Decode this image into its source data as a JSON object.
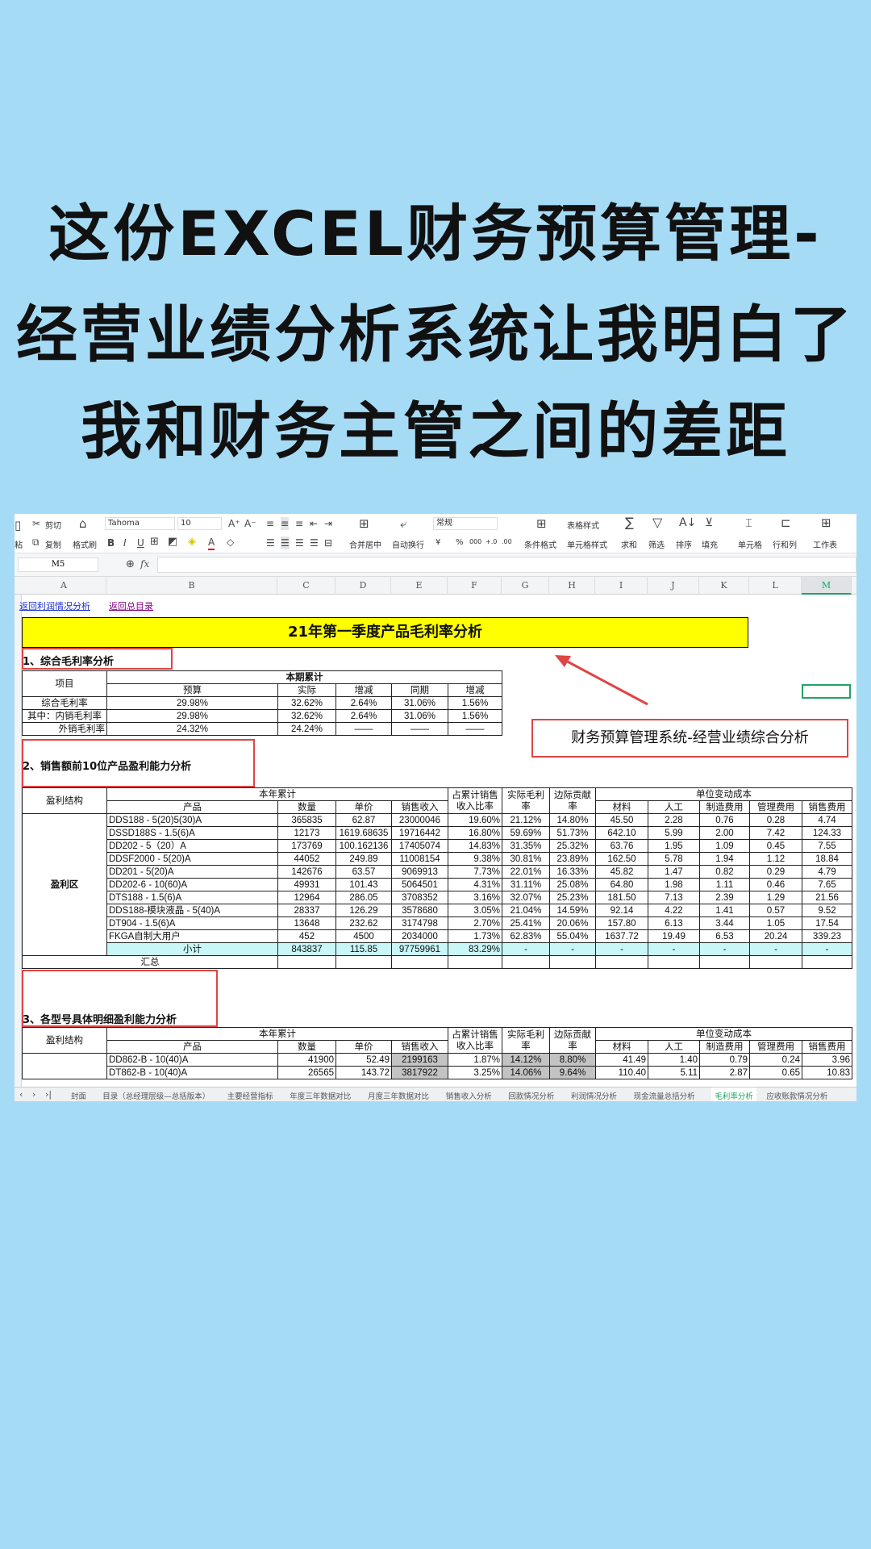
{
  "headline": {
    "lines": [
      "这份EXCEL财务预算管理-",
      "经营业绩分析系统让我明白了",
      "我和财务主管之间的差距"
    ]
  },
  "toolbar": {
    "paste": "粘",
    "cut": "剪切",
    "copy": "复制",
    "format_painter": "格式刷",
    "font": "Tahoma",
    "font_size": "10",
    "merge_center": "合并居中",
    "wrap_text": "自动换行",
    "number_format": "常规",
    "conditional_format": "条件格式",
    "table_style": "表格样式",
    "cell_style": "单元格样式",
    "sum": "求和",
    "filter": "筛选",
    "sort": "排序",
    "fill": "填充",
    "cell": "单元格",
    "row_col": "行和列",
    "worksheet": "工作表",
    "num_buttons": [
      "¥",
      "%",
      "000",
      "+.0",
      ".00"
    ]
  },
  "formula_bar": {
    "name_box": "M5",
    "fx": "fx",
    "value": ""
  },
  "columns": [
    "A",
    "B",
    "C",
    "D",
    "E",
    "F",
    "G",
    "H",
    "I",
    "J",
    "K",
    "L",
    "M"
  ],
  "selected_column": "M",
  "links": {
    "profit": "返回利润情况分析",
    "catalog": "返回总目录"
  },
  "sheet_title": "21年第一季度产品毛利率分析",
  "callout": "财务预算管理系统-经营业绩综合分析",
  "section1": {
    "heading": "1、综合毛利率分析",
    "item_header": "项目",
    "group_header": "本期累计",
    "headers": [
      "预算",
      "实际",
      "增减",
      "同期",
      "增减"
    ],
    "rows": [
      [
        "综合毛利率",
        "29.98%",
        "32.62%",
        "2.64%",
        "31.06%",
        "1.56%"
      ],
      [
        "其中：内销毛利率",
        "29.98%",
        "32.62%",
        "2.64%",
        "31.06%",
        "1.56%"
      ],
      [
        "外销毛利率",
        "24.32%",
        "24.24%",
        "——",
        "——",
        "——"
      ]
    ]
  },
  "section2": {
    "heading": "2、销售额前10位产品盈利能力分析",
    "structure_header": "盈利结构",
    "ytd_header": "本年累计",
    "unit_cost_header": "单位变动成本",
    "headers": [
      "产品",
      "数量",
      "单价",
      "销售收入",
      "占累计销售收入比率",
      "实际毛利率",
      "边际贡献率",
      "材料",
      "人工",
      "制造费用",
      "管理费用",
      "销售费用"
    ],
    "zone": "盈利区",
    "rows": [
      [
        "DDS188 - 5(20)5(30)A",
        "365835",
        "62.87",
        "23000046",
        "19.60%",
        "21.12%",
        "14.80%",
        "45.50",
        "2.28",
        "0.76",
        "0.28",
        "4.74"
      ],
      [
        "DSSD188S  - 1.5(6)A",
        "12173",
        "1619.68635",
        "19716442",
        "16.80%",
        "59.69%",
        "51.73%",
        "642.10",
        "5.99",
        "2.00",
        "7.42",
        "124.33"
      ],
      [
        "DD202 - 5（20）A",
        "173769",
        "100.162136",
        "17405074",
        "14.83%",
        "31.35%",
        "25.32%",
        "63.76",
        "1.95",
        "1.09",
        "0.45",
        "7.55"
      ],
      [
        "DDSF2000 - 5(20)A",
        "44052",
        "249.89",
        "11008154",
        "9.38%",
        "30.81%",
        "23.89%",
        "162.50",
        "5.78",
        "1.94",
        "1.12",
        "18.84"
      ],
      [
        "DD201 - 5(20)A",
        "142676",
        "63.57",
        "9069913",
        "7.73%",
        "22.01%",
        "16.33%",
        "45.82",
        "1.47",
        "0.82",
        "0.29",
        "4.79"
      ],
      [
        "DD202-6 - 10(60)A",
        "49931",
        "101.43",
        "5064501",
        "4.31%",
        "31.11%",
        "25.08%",
        "64.80",
        "1.98",
        "1.11",
        "0.46",
        "7.65"
      ],
      [
        "DTS188 - 1.5(6)A",
        "12964",
        "286.05",
        "3708352",
        "3.16%",
        "32.07%",
        "25.23%",
        "181.50",
        "7.13",
        "2.39",
        "1.29",
        "21.56"
      ],
      [
        "DDS188-模块液晶 - 5(40)A",
        "28337",
        "126.29",
        "3578680",
        "3.05%",
        "21.04%",
        "14.59%",
        "92.14",
        "4.22",
        "1.41",
        "0.57",
        "9.52"
      ],
      [
        "DT904 - 1.5(6)A",
        "13648",
        "232.62",
        "3174798",
        "2.70%",
        "25.41%",
        "20.06%",
        "157.80",
        "6.13",
        "3.44",
        "1.05",
        "17.54"
      ],
      [
        "FKGA自制大用户",
        "452",
        "4500",
        "2034000",
        "1.73%",
        "62.83%",
        "55.04%",
        "1637.72",
        "19.49",
        "6.53",
        "20.24",
        "339.23"
      ]
    ],
    "subtotal": [
      "小计",
      "843837",
      "115.85",
      "97759961",
      "83.29%",
      "-",
      "-",
      "-",
      "-",
      "-",
      "-",
      "-"
    ],
    "total_label": "汇总"
  },
  "section3": {
    "heading": "3、各型号具体明细盈利能力分析",
    "structure_header": "盈利结构",
    "ytd_header": "本年累计",
    "unit_cost_header": "单位变动成本",
    "headers": [
      "产品",
      "数量",
      "单价",
      "销售收入",
      "占累计销售收入比率",
      "实际毛利率",
      "边际贡献率",
      "材料",
      "人工",
      "制造费用",
      "管理费用",
      "销售费用"
    ],
    "rows": [
      [
        "DD862-B - 10(40)A",
        "41900",
        "52.49",
        "2199163",
        "1.87%",
        "14.12%",
        "8.80%",
        "41.49",
        "1.40",
        "0.79",
        "0.24",
        "3.96"
      ],
      [
        "DT862-B - 10(40)A",
        "26565",
        "143.72",
        "3817922",
        "3.25%",
        "14.06%",
        "9.64%",
        "110.40",
        "5.11",
        "2.87",
        "0.65",
        "10.83"
      ]
    ]
  },
  "sheet_tabs": [
    "封面",
    "目录（总经理层级—总括版本）",
    "主要经营指标",
    "年度三年数据对比",
    "月度三年数据对比",
    "销售收入分析",
    "回款情况分析",
    "利润情况分析",
    "现金流量总括分析",
    "毛利率分析",
    "应收账款情况分析"
  ],
  "active_tab": "毛利率分析",
  "colors": {
    "background": "#a6dbf6",
    "title_fill": "#ffff00",
    "subtotal_fill": "#c9f7f7",
    "annotation_red": "#e04444",
    "active_tab": "#1aa260"
  }
}
